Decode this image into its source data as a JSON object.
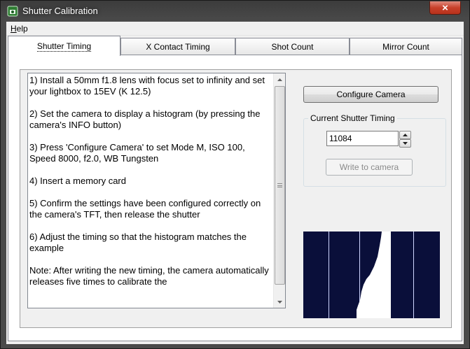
{
  "window": {
    "title": "Shutter Calibration",
    "close_symbol": "×"
  },
  "menu": {
    "help_prefix": "H",
    "help_rest": "elp"
  },
  "tabs": [
    {
      "label": "Shutter Timing",
      "active": true
    },
    {
      "label": "X Contact Timing",
      "active": false
    },
    {
      "label": "Shot Count",
      "active": false
    },
    {
      "label": "Mirror Count",
      "active": false
    }
  ],
  "instructions": [
    "1) Install a 50mm f1.8 lens with focus set to infinity and set your lightbox to 15EV (K 12.5)",
    "2) Set the camera to display a histogram (by pressing the camera's INFO button)",
    "3) Press 'Configure Camera' to set Mode M, ISO 100, Speed 8000, f2.0, WB Tungsten",
    "4) Insert a memory card",
    "5) Confirm the settings have been configured correctly on the camera's TFT, then release the shutter",
    "6) Adjust the timing so that the histogram matches the example",
    "Note: After writing the new timing, the camera automatically releases five times to calibrate the"
  ],
  "configure_button": "Configure Camera",
  "current_timing": {
    "legend": "Current Shutter Timing",
    "value": "11084",
    "write_button": "Write to camera",
    "write_enabled": false
  },
  "icons": {
    "app": "camera-app-icon",
    "close": "close-icon",
    "scroll_up": "scroll-up-arrow-icon",
    "scroll_down": "scroll-down-arrow-icon",
    "spin_up": "spin-up-arrow-icon",
    "spin_down": "spin-down-arrow-icon"
  },
  "colors": {
    "close_button": "#c7402a",
    "histogram_background": "#0a0f3a"
  }
}
